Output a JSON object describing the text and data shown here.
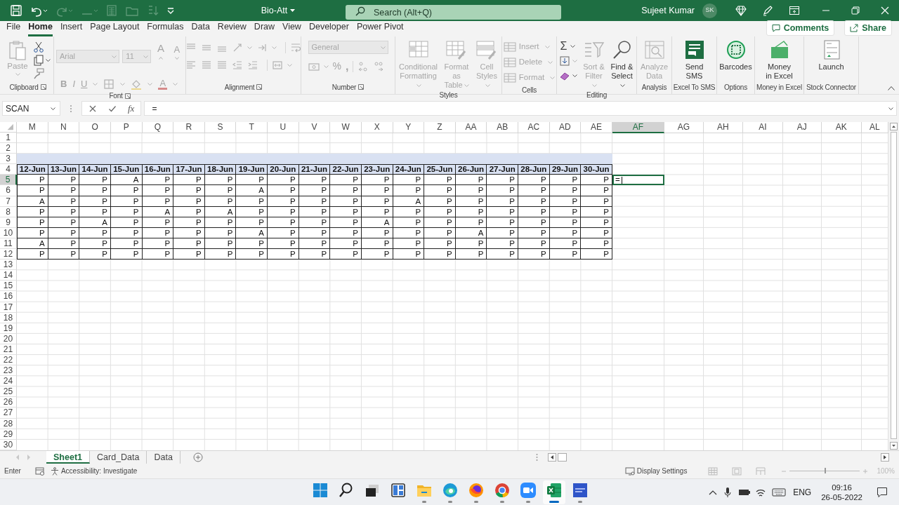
{
  "title_bar": {
    "quick_access": [
      {
        "disabled": false
      },
      {
        "disabled": false
      },
      {
        "disabled": true
      },
      {
        "disabled": true
      },
      {
        "disabled": true
      },
      {
        "disabled": true
      },
      {
        "disabled": true
      },
      {
        "disabled": false
      }
    ],
    "title": "Bio-Att",
    "search": {
      "placeholder": "Search (Alt+Q)"
    },
    "user": "Sujeet Kumar",
    "initials": "SK"
  },
  "tabs": [
    {
      "label": "File",
      "selected": false
    },
    {
      "label": "Home",
      "selected": true
    },
    {
      "label": "Insert",
      "selected": false
    },
    {
      "label": "Page Layout",
      "selected": false
    },
    {
      "label": "Formulas",
      "selected": false
    },
    {
      "label": "Data",
      "selected": false
    },
    {
      "label": "Review",
      "selected": false
    },
    {
      "label": "Draw",
      "selected": false
    },
    {
      "label": "View",
      "selected": false
    },
    {
      "label": "Developer",
      "selected": false
    },
    {
      "label": "Power Pivot",
      "selected": false
    }
  ],
  "comments_button": "Comments",
  "share_button": "Share",
  "ribbon": [
    {
      "kind": "clipboard",
      "label": "Clipboard",
      "launcher": true,
      "paste": {
        "label": "Paste",
        "disabled": true
      }
    },
    {
      "kind": "font",
      "label": "Font",
      "launcher": true,
      "disabled": true,
      "font_name": "Arial",
      "font_size": "11",
      "grow_font": "A",
      "shrink_font": "A",
      "bold": "B",
      "italic": "I",
      "underline": "U",
      "font_color": "A"
    },
    {
      "kind": "alignment",
      "label": "Alignment",
      "launcher": true,
      "disabled": true
    },
    {
      "kind": "number",
      "label": "Number",
      "launcher": true,
      "disabled": true,
      "format": "General",
      "percent": "%",
      "comma": ","
    },
    {
      "kind": "buttons",
      "label": "Styles",
      "launcher": false,
      "buttons": [
        {
          "label": "Conditional\nFormatting",
          "disabled": true,
          "dropdown": true
        },
        {
          "label": "Format as\nTable",
          "disabled": true,
          "dropdown": true
        },
        {
          "label": "Cell\nStyles",
          "disabled": true,
          "dropdown": true
        }
      ]
    },
    {
      "kind": "cells",
      "label": "Cells",
      "launcher": false,
      "buttons": [
        {
          "label": "Insert",
          "disabled": true
        },
        {
          "label": "Delete",
          "disabled": true
        },
        {
          "label": "Format",
          "disabled": true
        }
      ]
    },
    {
      "kind": "editing",
      "label": "Editing",
      "launcher": false,
      "autosum": "Σ",
      "buttons": [
        {
          "label": "Sort &\nFilter",
          "disabled": true,
          "dropdown": true
        },
        {
          "label": "Find &\nSelect",
          "disabled": false,
          "dropdown": true
        }
      ]
    },
    {
      "kind": "buttons",
      "label": "Analysis",
      "launcher": false,
      "buttons": [
        {
          "label": "Analyze\nData",
          "disabled": true,
          "dropdown": false
        }
      ]
    },
    {
      "kind": "buttons",
      "label": "Excel To SMS",
      "launcher": false,
      "buttons": [
        {
          "label": "Send\nSMS",
          "disabled": false,
          "dropdown": false
        }
      ]
    },
    {
      "kind": "buttons",
      "label": "Options",
      "launcher": false,
      "buttons": [
        {
          "label": "Barcodes",
          "disabled": false,
          "dropdown": false
        }
      ]
    },
    {
      "kind": "buttons",
      "label": "Money in Excel",
      "launcher": false,
      "buttons": [
        {
          "label": "Money\nin Excel",
          "disabled": false,
          "dropdown": false
        }
      ]
    },
    {
      "kind": "buttons",
      "label": "Stock Connector",
      "launcher": false,
      "buttons": [
        {
          "label": "Launch",
          "disabled": false,
          "dropdown": false
        }
      ]
    }
  ],
  "formula_bar": {
    "name_box": "SCAN",
    "function_label": "fx",
    "formula": "="
  },
  "sheet": {
    "columns": [
      {
        "label": "M",
        "selected": false
      },
      {
        "label": "N",
        "selected": false
      },
      {
        "label": "O",
        "selected": false
      },
      {
        "label": "P",
        "selected": false
      },
      {
        "label": "Q",
        "selected": false
      },
      {
        "label": "R",
        "selected": false
      },
      {
        "label": "S",
        "selected": false
      },
      {
        "label": "T",
        "selected": false
      },
      {
        "label": "U",
        "selected": false
      },
      {
        "label": "V",
        "selected": false
      },
      {
        "label": "W",
        "selected": false
      },
      {
        "label": "X",
        "selected": false
      },
      {
        "label": "Y",
        "selected": false
      },
      {
        "label": "Z",
        "selected": false
      },
      {
        "label": "AA",
        "selected": false
      },
      {
        "label": "AB",
        "selected": false
      },
      {
        "label": "AC",
        "selected": false
      },
      {
        "label": "AD",
        "selected": false
      },
      {
        "label": "AE",
        "selected": false
      },
      {
        "label": "AF",
        "selected": true
      },
      {
        "label": "AG",
        "selected": false
      },
      {
        "label": "AH",
        "selected": false
      },
      {
        "label": "AI",
        "selected": false
      },
      {
        "label": "AJ",
        "selected": false
      },
      {
        "label": "AK",
        "selected": false
      },
      {
        "label": "AL",
        "selected": false
      }
    ],
    "rows": [
      {
        "number": "1",
        "kind": "empty",
        "selected": false
      },
      {
        "number": "2",
        "kind": "empty",
        "selected": false
      },
      {
        "number": "3",
        "kind": "band",
        "selected": false
      },
      {
        "number": "4",
        "kind": "header",
        "selected": false,
        "cells": [
          "12-Jun",
          "13-Jun",
          "14-Jun",
          "15-Jun",
          "16-Jun",
          "17-Jun",
          "18-Jun",
          "19-Jun",
          "20-Jun",
          "21-Jun",
          "22-Jun",
          "23-Jun",
          "24-Jun",
          "25-Jun",
          "26-Jun",
          "27-Jun",
          "28-Jun",
          "29-Jun",
          "30-Jun"
        ]
      },
      {
        "number": "5",
        "kind": "data",
        "selected": true,
        "active_value": "=",
        "cells": [
          "P",
          "P",
          "P",
          "A",
          "P",
          "P",
          "P",
          "P",
          "P",
          "P",
          "P",
          "P",
          "P",
          "P",
          "P",
          "P",
          "P",
          "P",
          "P"
        ]
      },
      {
        "number": "6",
        "kind": "data",
        "selected": false,
        "cells": [
          "P",
          "P",
          "P",
          "P",
          "P",
          "P",
          "P",
          "A",
          "P",
          "P",
          "P",
          "P",
          "P",
          "P",
          "P",
          "P",
          "P",
          "P",
          "P"
        ]
      },
      {
        "number": "7",
        "kind": "data",
        "selected": false,
        "cells": [
          "A",
          "P",
          "P",
          "P",
          "P",
          "P",
          "P",
          "P",
          "P",
          "P",
          "P",
          "P",
          "A",
          "P",
          "P",
          "P",
          "P",
          "P",
          "P"
        ]
      },
      {
        "number": "8",
        "kind": "data",
        "selected": false,
        "cells": [
          "P",
          "P",
          "P",
          "P",
          "A",
          "P",
          "A",
          "P",
          "P",
          "P",
          "P",
          "P",
          "P",
          "P",
          "P",
          "P",
          "P",
          "P",
          "P"
        ]
      },
      {
        "number": "9",
        "kind": "data",
        "selected": false,
        "cells": [
          "P",
          "P",
          "A",
          "P",
          "P",
          "P",
          "P",
          "P",
          "P",
          "P",
          "P",
          "A",
          "P",
          "P",
          "P",
          "P",
          "P",
          "P",
          "P"
        ]
      },
      {
        "number": "10",
        "kind": "data",
        "selected": false,
        "cells": [
          "P",
          "P",
          "P",
          "P",
          "P",
          "P",
          "P",
          "A",
          "P",
          "P",
          "P",
          "P",
          "P",
          "P",
          "A",
          "P",
          "P",
          "P",
          "P"
        ]
      },
      {
        "number": "11",
        "kind": "data",
        "selected": false,
        "cells": [
          "A",
          "P",
          "P",
          "P",
          "P",
          "P",
          "P",
          "P",
          "P",
          "P",
          "P",
          "P",
          "P",
          "P",
          "P",
          "P",
          "P",
          "P",
          "P"
        ]
      },
      {
        "number": "12",
        "kind": "data",
        "selected": false,
        "cells": [
          "P",
          "P",
          "P",
          "P",
          "P",
          "P",
          "P",
          "P",
          "P",
          "P",
          "P",
          "P",
          "P",
          "P",
          "P",
          "P",
          "P",
          "P",
          "P"
        ]
      },
      {
        "number": "13",
        "kind": "empty",
        "selected": false
      },
      {
        "number": "14",
        "kind": "empty",
        "selected": false
      },
      {
        "number": "15",
        "kind": "empty",
        "selected": false
      },
      {
        "number": "16",
        "kind": "empty",
        "selected": false
      },
      {
        "number": "17",
        "kind": "empty",
        "selected": false
      },
      {
        "number": "18",
        "kind": "empty",
        "selected": false
      },
      {
        "number": "19",
        "kind": "empty",
        "selected": false
      },
      {
        "number": "20",
        "kind": "empty",
        "selected": false
      },
      {
        "number": "21",
        "kind": "empty",
        "selected": false
      },
      {
        "number": "22",
        "kind": "empty",
        "selected": false
      },
      {
        "number": "23",
        "kind": "empty",
        "selected": false
      },
      {
        "number": "24",
        "kind": "empty",
        "selected": false
      },
      {
        "number": "25",
        "kind": "empty",
        "selected": false
      },
      {
        "number": "26",
        "kind": "empty",
        "selected": false
      },
      {
        "number": "27",
        "kind": "empty",
        "selected": false
      },
      {
        "number": "28",
        "kind": "empty",
        "selected": false
      },
      {
        "number": "29",
        "kind": "empty",
        "selected": false
      },
      {
        "number": "30",
        "kind": "empty",
        "selected": false
      }
    ]
  },
  "sheet_tabs": [
    {
      "label": "Sheet1",
      "selected": true
    },
    {
      "label": "Card_Data",
      "selected": false
    },
    {
      "label": "Data",
      "selected": false
    }
  ],
  "status_bar": {
    "mode": "Enter",
    "accessibility": "Accessibility: Investigate",
    "display_settings": "Display Settings",
    "zoom": {
      "level": 0.5,
      "reading": "100%"
    }
  },
  "taskbar": {
    "apps": [
      {
        "running": false,
        "selected": false
      },
      {
        "running": false,
        "selected": false
      },
      {
        "running": false,
        "selected": false
      },
      {
        "running": false,
        "selected": false
      },
      {
        "running": true,
        "selected": false
      },
      {
        "running": true,
        "selected": false
      },
      {
        "running": true,
        "selected": false
      },
      {
        "running": true,
        "selected": false
      },
      {
        "running": true,
        "selected": false
      },
      {
        "running": true,
        "selected": true
      },
      {
        "running": true,
        "selected": false
      }
    ],
    "language": "ENG",
    "time": "09:16",
    "date": "26-05-2022"
  }
}
